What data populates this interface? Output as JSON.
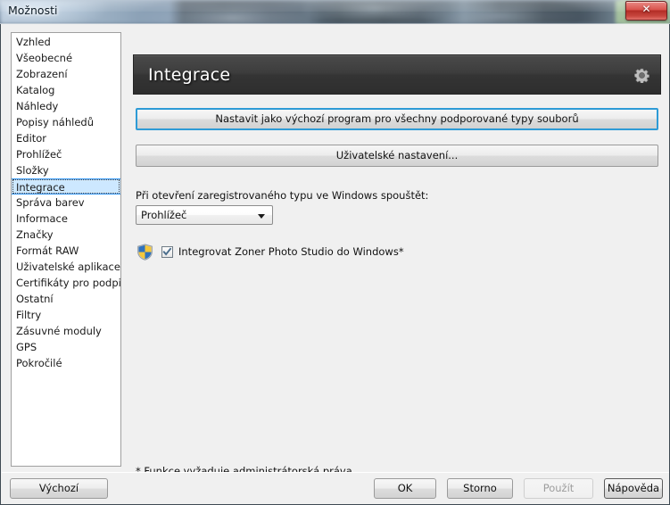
{
  "window": {
    "title": "Možnosti",
    "close_label": "Zavřít",
    "close_icon": "close-icon"
  },
  "sidebar": {
    "items": [
      {
        "label": "Vzhled",
        "selected": false
      },
      {
        "label": "Všeobecné",
        "selected": false
      },
      {
        "label": "Zobrazení",
        "selected": false
      },
      {
        "label": "Katalog",
        "selected": false
      },
      {
        "label": "Náhledy",
        "selected": false
      },
      {
        "label": "Popisy náhledů",
        "selected": false
      },
      {
        "label": "Editor",
        "selected": false
      },
      {
        "label": "Prohlížeč",
        "selected": false
      },
      {
        "label": "Složky",
        "selected": false
      },
      {
        "label": "Integrace",
        "selected": true
      },
      {
        "label": "Správa barev",
        "selected": false
      },
      {
        "label": "Informace",
        "selected": false
      },
      {
        "label": "Značky",
        "selected": false
      },
      {
        "label": "Formát RAW",
        "selected": false
      },
      {
        "label": "Uživatelské aplikace",
        "selected": false
      },
      {
        "label": "Certifikáty pro podpis",
        "selected": false
      },
      {
        "label": "Ostatní",
        "selected": false
      },
      {
        "label": "Filtry",
        "selected": false
      },
      {
        "label": "Zásuvné moduly",
        "selected": false
      },
      {
        "label": "GPS",
        "selected": false
      },
      {
        "label": "Pokročilé",
        "selected": false
      }
    ]
  },
  "panel": {
    "header_title": "Integrace",
    "header_gear_icon": "gear-icon",
    "default_program_button": "Nastavit jako výchozí program pro všechny podporované typy souborů",
    "user_settings_button": "Uživatelské nastavení...",
    "open_type_label": "Při otevření zaregistrovaného typu ve Windows spouštět:",
    "open_type_value": "Prohlížeč",
    "open_type_options": [
      "Prohlížeč"
    ],
    "integrate_checkbox_label": "Integrovat Zoner Photo Studio do Windows*",
    "integrate_checkbox_checked": true,
    "shield_icon": "uac-shield-icon",
    "footnote": "* Funkce vyžaduje administrátorská práva."
  },
  "footer": {
    "defaults_label": "Výchozí",
    "ok_label": "OK",
    "cancel_label": "Storno",
    "apply_label": "Použít",
    "apply_disabled": true,
    "help_label": "Nápověda"
  },
  "colors": {
    "selection_fill": "#cde8ff",
    "selection_border": "#3399ff",
    "focus_border": "#2e9bd6",
    "header_dark": "#3d3d3d",
    "dialog_bg": "#f0f0f0",
    "close_red": "#d9534c"
  }
}
